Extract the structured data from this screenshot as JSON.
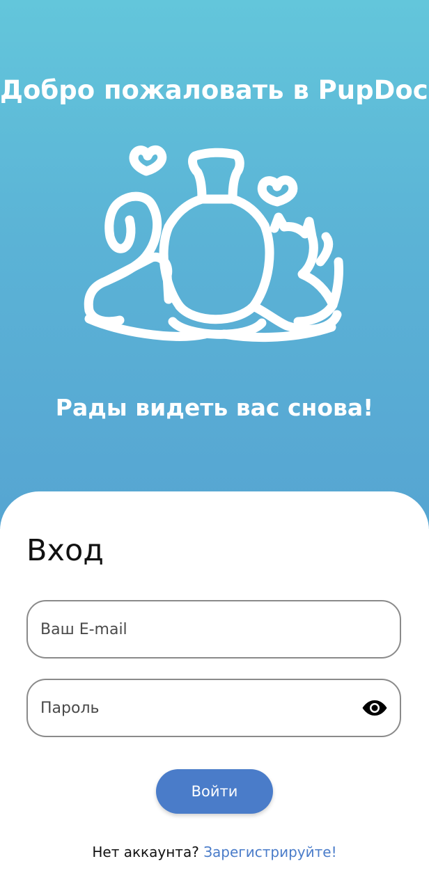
{
  "hero": {
    "title": "Добро пожаловать в PupDoc!",
    "subtitle": "Рады видеть вас снова!",
    "illustration_icon": "person-with-pets-hearts-icon"
  },
  "login": {
    "heading": "Вход",
    "email_placeholder": "Ваш E-mail",
    "password_placeholder": "Пароль",
    "show_password_icon": "eye-icon",
    "submit_label": "Войти"
  },
  "register": {
    "prompt": "Нет аккаунта?",
    "link_label": "Зарегистрируйте!"
  },
  "colors": {
    "hero_gradient_top": "#63c6db",
    "hero_gradient_bottom": "#56a5d2",
    "accent": "#4a7cc9",
    "card": "#ffffff"
  }
}
